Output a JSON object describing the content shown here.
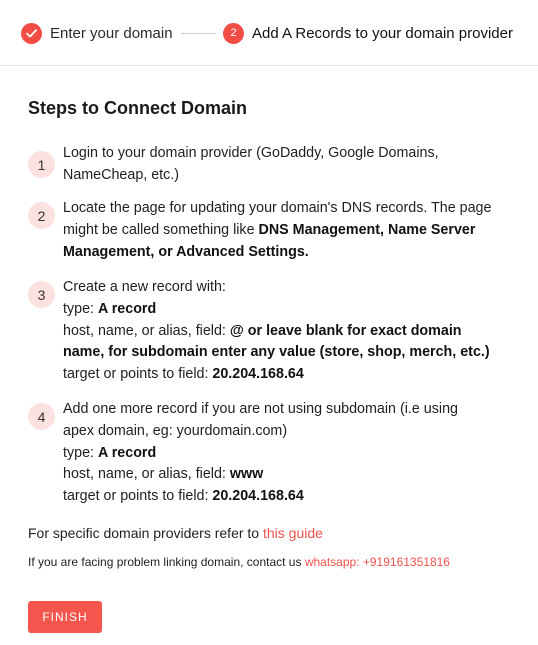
{
  "stepper": {
    "step1_label": "Enter your domain",
    "step2_number": "2",
    "step2_label": "Add A Records to your domain provider"
  },
  "title": "Steps to Connect Domain",
  "steps": [
    {
      "number": "1",
      "line1": "Login to your domain provider (GoDaddy, Google Domains,",
      "line2": "NameCheap, etc.)"
    },
    {
      "number": "2",
      "line1": "Locate the page for updating your domain's DNS records. The page",
      "line2_pre": "might be called something like ",
      "line2_bold": "DNS Management, Name Server",
      "line3_bold": "Management, or Advanced Settings."
    },
    {
      "number": "3",
      "line1": "Create a new record with:",
      "type_label": "type: ",
      "type_value": "A record",
      "host_label": "host, name, or alias, field: ",
      "host_value_1": "@ or leave blank for exact domain",
      "host_value_2": "name, for subdomain enter any value (store, shop, merch, etc.)",
      "target_label": "target or points to field: ",
      "target_value": "20.204.168.64"
    },
    {
      "number": "4",
      "line1": "Add one more record if you are not using subdomain (i.e using",
      "line2": "apex domain, eg: yourdomain.com)",
      "type_label": "type: ",
      "type_value": "A record",
      "host_label": "host, name, or alias, field: ",
      "host_value": "www",
      "target_label": "target or points to field: ",
      "target_value": "20.204.168.64"
    }
  ],
  "guide": {
    "text": "For specific domain providers refer to this ",
    "link": "this guide"
  },
  "contact": {
    "text": "If you are facing problem linking domain, contact us ",
    "link": "whatsapp: +919161351816"
  },
  "finish_label": "FINISH",
  "colors": {
    "accent": "#f24d45",
    "badge_bg": "#fbe1df",
    "link": "#f0524a"
  },
  "icons": {
    "step1": "check-icon"
  }
}
